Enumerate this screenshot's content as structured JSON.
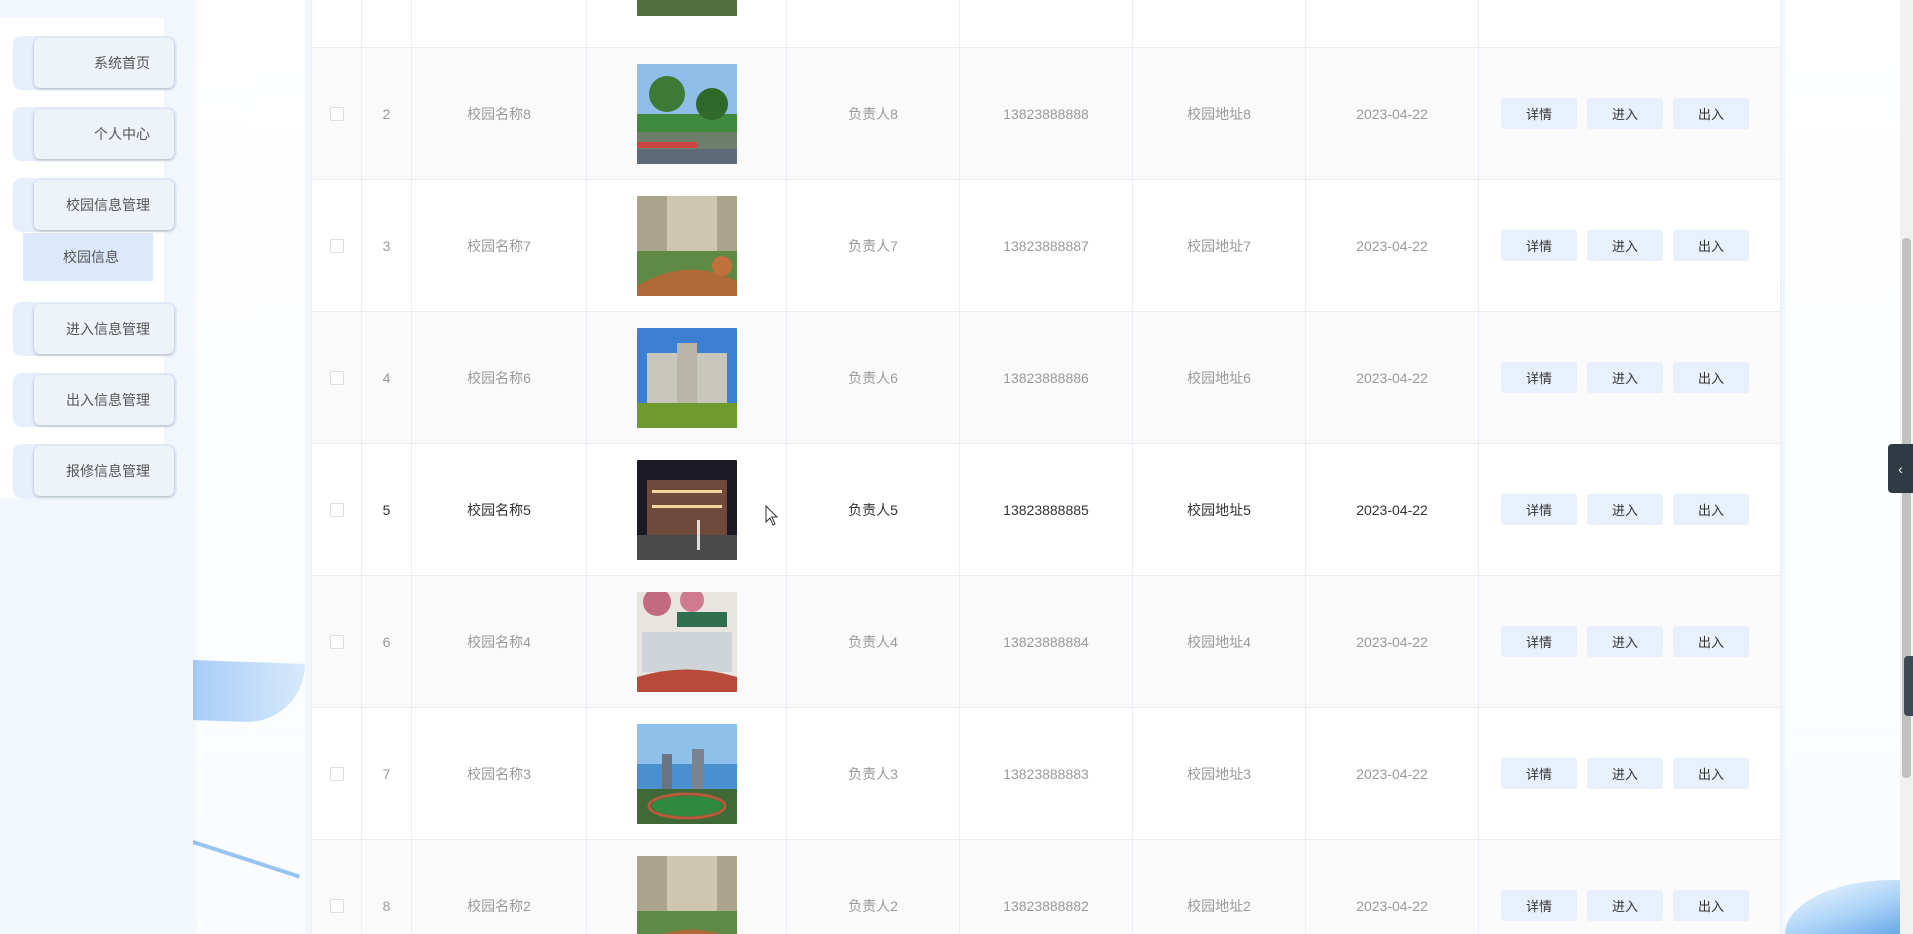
{
  "sidebar": {
    "items": [
      {
        "label": "系统首页"
      },
      {
        "label": "个人中心"
      },
      {
        "label": "校园信息管理"
      },
      {
        "label": "进入信息管理"
      },
      {
        "label": "出入信息管理"
      },
      {
        "label": "报修信息管理"
      }
    ],
    "submenu": {
      "label": "校园信息"
    }
  },
  "table": {
    "buttons": {
      "detail": "详情",
      "enter": "进入",
      "exit": "出入"
    },
    "rows": [
      {
        "index": "2",
        "name": "校园名称8",
        "person": "负责人8",
        "phone": "13823888888",
        "address": "校园地址8",
        "date": "2023-04-22"
      },
      {
        "index": "3",
        "name": "校园名称7",
        "person": "负责人7",
        "phone": "13823888887",
        "address": "校园地址7",
        "date": "2023-04-22"
      },
      {
        "index": "4",
        "name": "校园名称6",
        "person": "负责人6",
        "phone": "13823888886",
        "address": "校园地址6",
        "date": "2023-04-22"
      },
      {
        "index": "5",
        "name": "校园名称5",
        "person": "负责人5",
        "phone": "13823888885",
        "address": "校园地址5",
        "date": "2023-04-22"
      },
      {
        "index": "6",
        "name": "校园名称4",
        "person": "负责人4",
        "phone": "13823888884",
        "address": "校园地址4",
        "date": "2023-04-22"
      },
      {
        "index": "7",
        "name": "校园名称3",
        "person": "负责人3",
        "phone": "13823888883",
        "address": "校园地址3",
        "date": "2023-04-22"
      },
      {
        "index": "8",
        "name": "校园名称2",
        "person": "负责人2",
        "phone": "13823888882",
        "address": "校园地址2",
        "date": "2023-04-22"
      }
    ]
  },
  "colors": {
    "accent": "#e8f0fb",
    "sidebar_bg": "#f2f7fd",
    "border": "#ebeef5"
  }
}
